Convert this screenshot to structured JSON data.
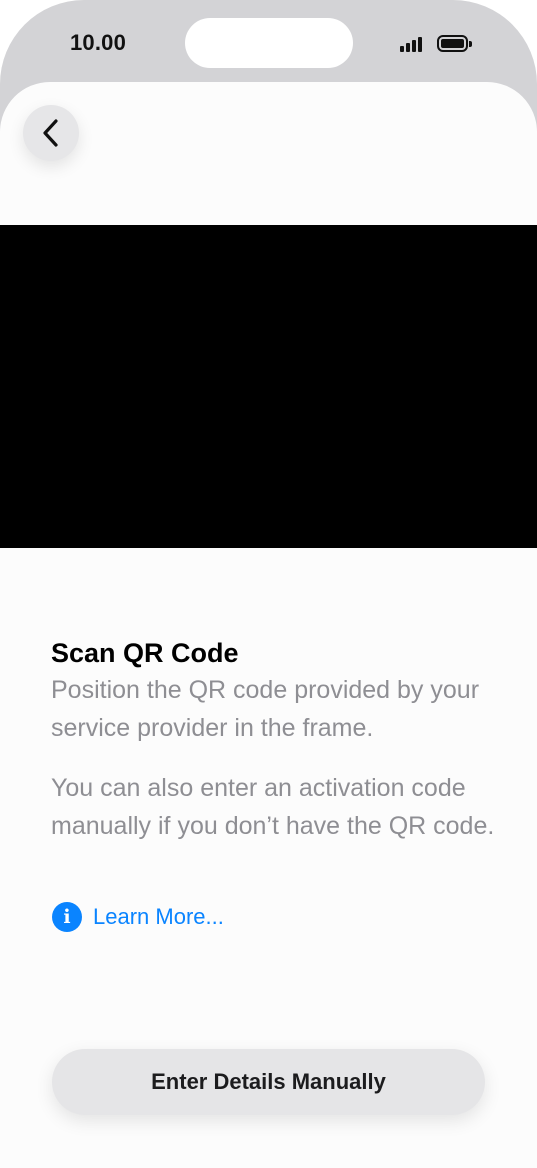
{
  "status_bar": {
    "time": "10.00",
    "signal_icon": "cellular-signal-icon",
    "battery_icon": "battery-icon"
  },
  "nav": {
    "back_icon": "chevron-left-icon"
  },
  "content": {
    "title": "Scan QR Code",
    "instruction": "Position the QR code provided by your service provider in the frame.",
    "alternative": "You can also enter an activation code manually if you don’t have the QR code.",
    "learn_more_icon": "info-icon",
    "learn_more_label": "Learn More..."
  },
  "actions": {
    "manual_button_label": "Enter Details Manually"
  },
  "colors": {
    "accent": "#0a84ff",
    "secondary_text": "#8e8e93",
    "camera_background": "#000000",
    "button_background": "#e5e5e7"
  }
}
